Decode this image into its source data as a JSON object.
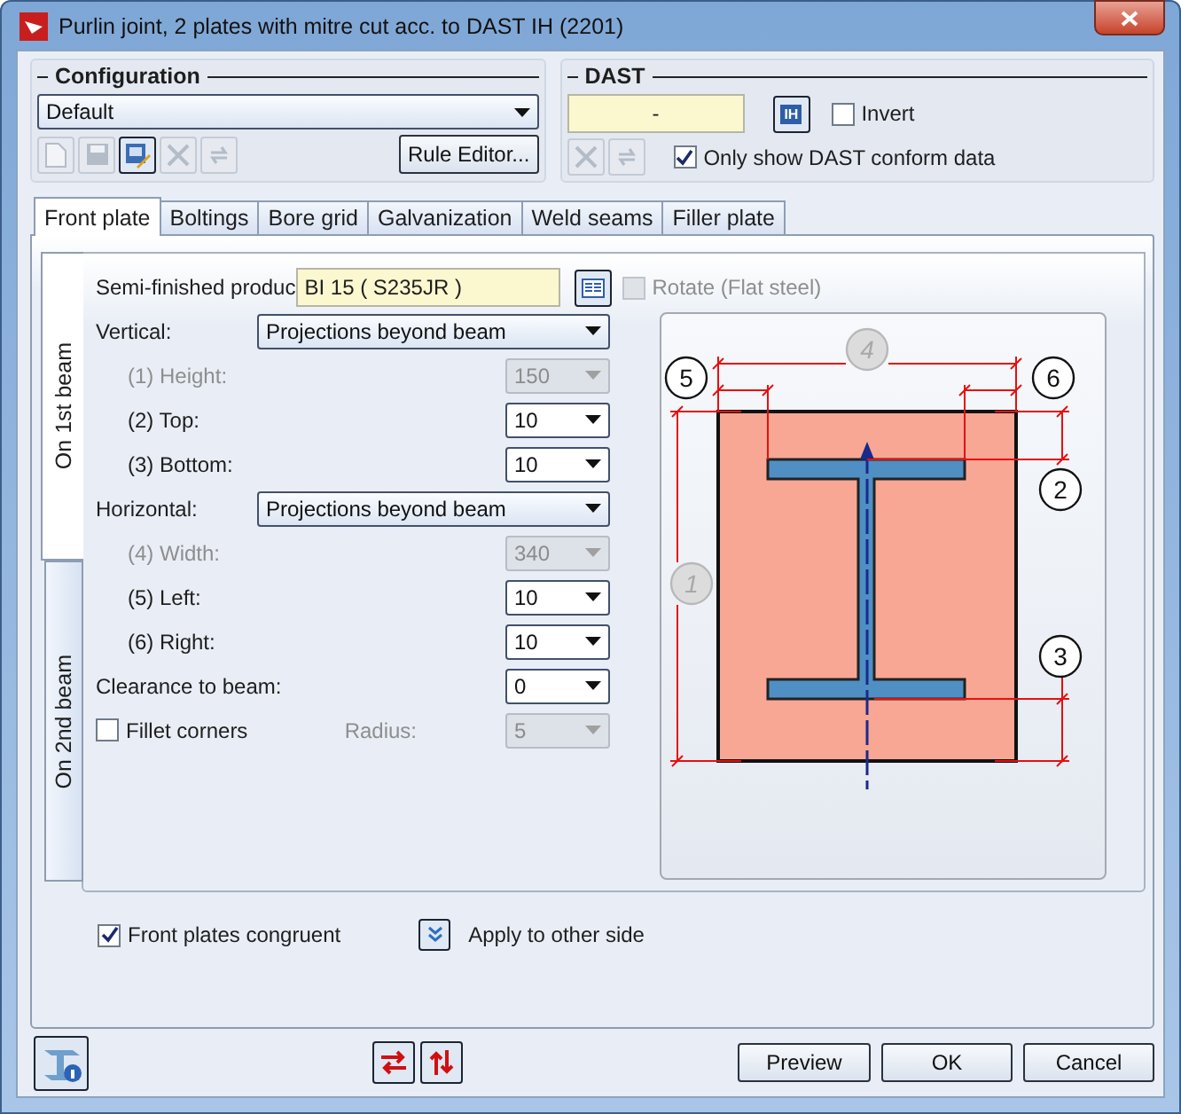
{
  "window": {
    "title": "Purlin joint, 2 plates with mitre cut acc. to DAST IH (2201)"
  },
  "configuration": {
    "title": "Configuration",
    "preset": "Default",
    "rule_editor": "Rule Editor...",
    "tools": [
      {
        "kind": "new",
        "disabled": true
      },
      {
        "kind": "save",
        "disabled": true
      },
      {
        "kind": "edit",
        "disabled": false
      },
      {
        "kind": "delete",
        "disabled": true
      },
      {
        "kind": "refresh",
        "disabled": true
      }
    ]
  },
  "dast": {
    "title": "DAST",
    "value": "-",
    "catalog": "IH",
    "invert": {
      "label": "Invert",
      "checked": false
    },
    "tools": [
      {
        "kind": "delete",
        "disabled": true
      },
      {
        "kind": "refresh",
        "disabled": true
      }
    ],
    "conform": {
      "label": "Only show DAST conform data",
      "checked": true
    }
  },
  "tabs": [
    {
      "label": "Front plate",
      "selected": true
    },
    {
      "label": "Boltings",
      "selected": false
    },
    {
      "label": "Bore grid",
      "selected": false
    },
    {
      "label": "Galvanization",
      "selected": false
    },
    {
      "label": "Weld seams",
      "selected": false
    },
    {
      "label": "Filler plate",
      "selected": false
    }
  ],
  "side_tabs": [
    {
      "label": "On 1st beam",
      "selected": true
    },
    {
      "label": "On 2nd beam",
      "selected": false
    }
  ],
  "form": {
    "semi_finished": {
      "label": "Semi-finished produc",
      "value": "BI 15  ( S235JR )"
    },
    "rotate": {
      "label": "Rotate (Flat steel)",
      "checked": false,
      "disabled": true
    },
    "rows": [
      {
        "kind": "select",
        "label": "Vertical:",
        "value": "Projections beyond beam",
        "disabled": false,
        "children": [
          {
            "kind": "number",
            "label": "(1) Height:",
            "value": "150",
            "disabled": true
          },
          {
            "kind": "number",
            "label": "(2) Top:",
            "value": "10",
            "disabled": false
          },
          {
            "kind": "number",
            "label": "(3) Bottom:",
            "value": "10",
            "disabled": false
          }
        ]
      },
      {
        "kind": "select",
        "label": "Horizontal:",
        "value": "Projections beyond beam",
        "disabled": false,
        "children": [
          {
            "kind": "number",
            "label": "(4) Width:",
            "value": "340",
            "disabled": true
          },
          {
            "kind": "number",
            "label": "(5) Left:",
            "value": "10",
            "disabled": false
          },
          {
            "kind": "number",
            "label": "(6) Right:",
            "value": "10",
            "disabled": false
          }
        ]
      },
      {
        "kind": "number",
        "label": "Clearance to beam:",
        "value": "0",
        "disabled": false
      }
    ],
    "fillet": {
      "label": "Fillet corners",
      "checked": false
    },
    "radius": {
      "label": "Radius:",
      "value": "5",
      "disabled": true
    }
  },
  "diagram": {
    "markers": [
      {
        "text": "4",
        "disabled": true
      },
      {
        "text": "5",
        "disabled": false
      },
      {
        "text": "6",
        "disabled": false
      },
      {
        "text": "2",
        "disabled": false
      },
      {
        "text": "3",
        "disabled": false
      },
      {
        "text": "1",
        "disabled": true
      }
    ]
  },
  "options": {
    "congruent": {
      "label": "Front plates congruent",
      "checked": true
    },
    "apply": "Apply to other side"
  },
  "footer": {
    "buttons": [
      "Preview",
      "OK",
      "Cancel"
    ]
  }
}
